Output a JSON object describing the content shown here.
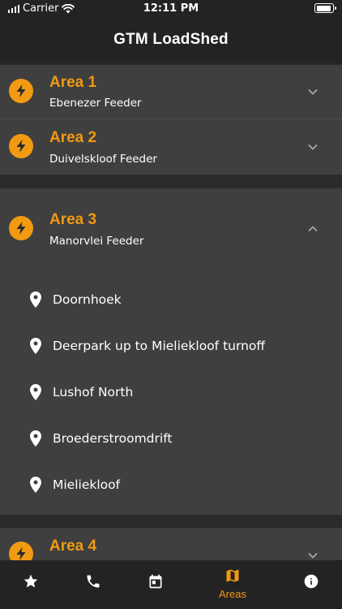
{
  "status_bar": {
    "carrier": "Carrier",
    "time": "12:11 PM"
  },
  "app_bar": {
    "title": "GTM LoadShed"
  },
  "areas": [
    {
      "title": "Area 1",
      "feeder": "Ebenezer Feeder",
      "expanded": false
    },
    {
      "title": "Area 2",
      "feeder": "Duivelskloof Feeder",
      "expanded": false
    },
    {
      "title": "Area 3",
      "feeder": "Manorvlei Feeder",
      "expanded": true,
      "locations": [
        "Doornhoek",
        "Deerpark up to Mieliekloof turnoff",
        "Lushof North",
        "Broederstroomdrift",
        "Mieliekloof"
      ]
    },
    {
      "title": "Area 4",
      "feeder": "",
      "expanded": false
    }
  ],
  "bottom_nav": {
    "items": [
      {
        "icon": "star-icon",
        "label": ""
      },
      {
        "icon": "phone-icon",
        "label": ""
      },
      {
        "icon": "calendar-icon",
        "label": ""
      },
      {
        "icon": "map-icon",
        "label": "Areas",
        "active": true
      },
      {
        "icon": "info-icon",
        "label": ""
      }
    ]
  },
  "colors": {
    "accent": "#f29a12",
    "card": "#3f3f3f",
    "background": "#2b2b2b",
    "bar": "#232323"
  }
}
